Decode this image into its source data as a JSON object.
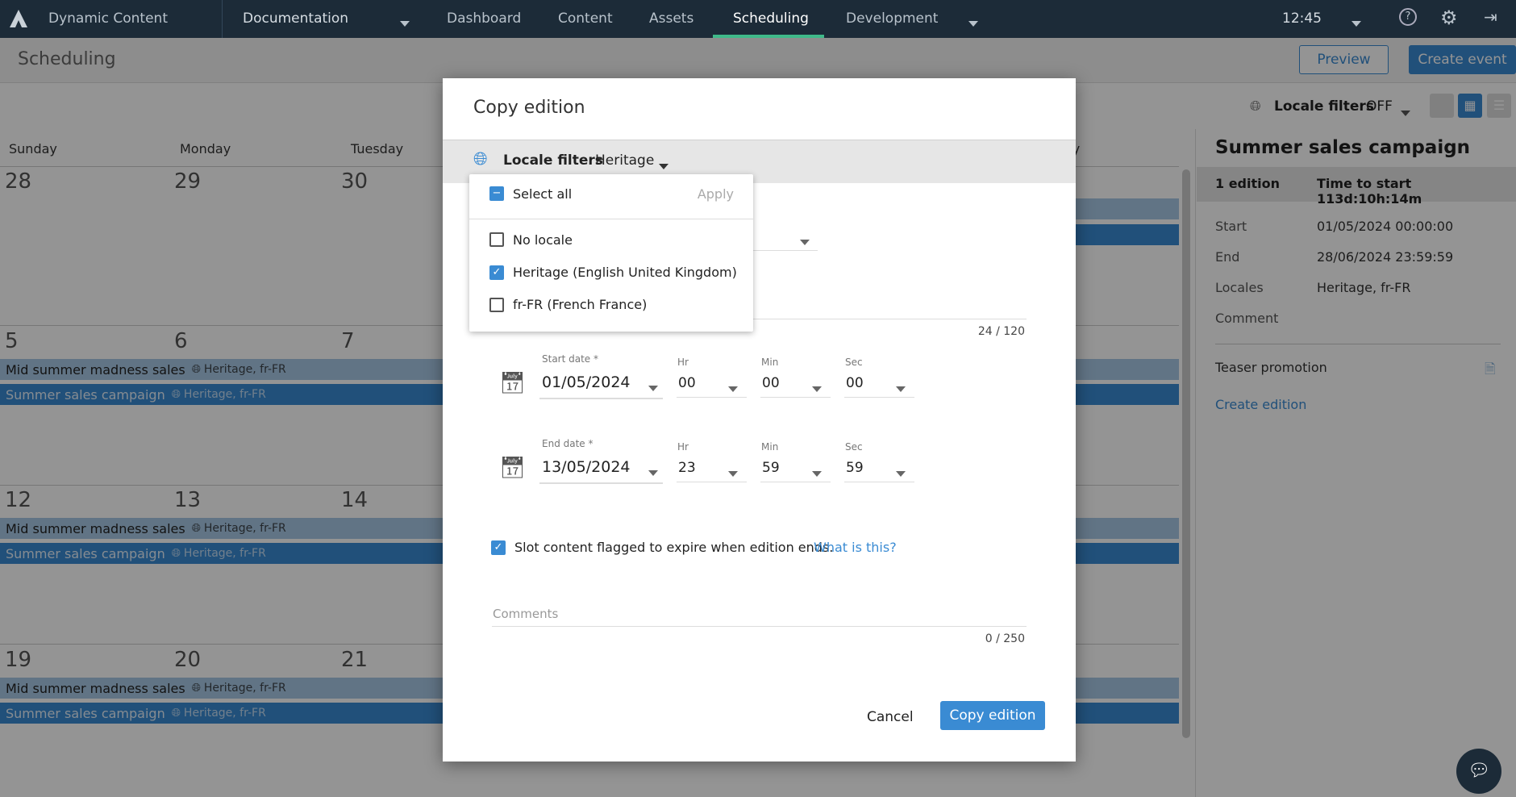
{
  "nav": {
    "app": "Dynamic Content",
    "hub": "Documentation",
    "items": [
      "Dashboard",
      "Content",
      "Assets",
      "Scheduling",
      "Development"
    ],
    "active": "Scheduling",
    "time": "12:45",
    "accent": "#3fb98a"
  },
  "sub": {
    "title": "Scheduling",
    "preview": "Preview",
    "create_event": "Create event"
  },
  "toolbar": {
    "locale_label": "Locale filters",
    "locale_value": "OFF"
  },
  "calendar": {
    "weekdays": [
      "Sunday",
      "Monday",
      "Tuesday",
      "ay"
    ],
    "weeks": [
      [
        "28",
        "29",
        "30"
      ],
      [
        "5",
        "6",
        "7"
      ],
      [
        "12",
        "13",
        "14"
      ],
      [
        "19",
        "20",
        "21"
      ]
    ],
    "events": [
      {
        "name": "Mid summer madness sales",
        "locales": "Heritage, fr-FR",
        "color": "#a8c9e6"
      },
      {
        "name": "Summer sales campaign",
        "locales": "Heritage, fr-FR",
        "color": "#3a8bd3"
      }
    ]
  },
  "panel": {
    "title": "Summer sales campaign",
    "editions": "1 edition",
    "time_to_start": "Time to start 113d:10h:14m",
    "rows": [
      {
        "k": "Start",
        "v": "01/05/2024 00:00:00"
      },
      {
        "k": "End",
        "v": "28/06/2024 23:59:59"
      },
      {
        "k": "Locales",
        "v": "Heritage, fr-FR"
      },
      {
        "k": "Comment",
        "v": ""
      }
    ],
    "edition_name": "Teaser promotion",
    "create_edition": "Create edition"
  },
  "dialog": {
    "title": "Copy edition",
    "locale_label": "Locale filters",
    "locale_value": "Heritage",
    "dropdown": {
      "select_all": "Select all",
      "apply": "Apply",
      "options": [
        {
          "label": "No locale",
          "checked": false
        },
        {
          "label": "Heritage (English United Kingdom)",
          "checked": true
        },
        {
          "label": "fr-FR (French France)",
          "checked": false
        }
      ]
    },
    "name_counter": "24 / 120",
    "start": {
      "label": "Start date *",
      "date": "01/05/2024",
      "hr": "00",
      "min": "00",
      "sec": "00"
    },
    "end": {
      "label": "End date *",
      "date": "13/05/2024",
      "hr": "23",
      "min": "59",
      "sec": "59"
    },
    "time_labels": {
      "hr": "Hr",
      "min": "Min",
      "sec": "Sec"
    },
    "expire_text": "Slot content flagged to expire when edition ends.",
    "expire_checked": true,
    "what_is_this": "What is this?",
    "comments_placeholder": "Comments",
    "comments_counter": "0 / 250",
    "cancel": "Cancel",
    "submit": "Copy edition"
  }
}
